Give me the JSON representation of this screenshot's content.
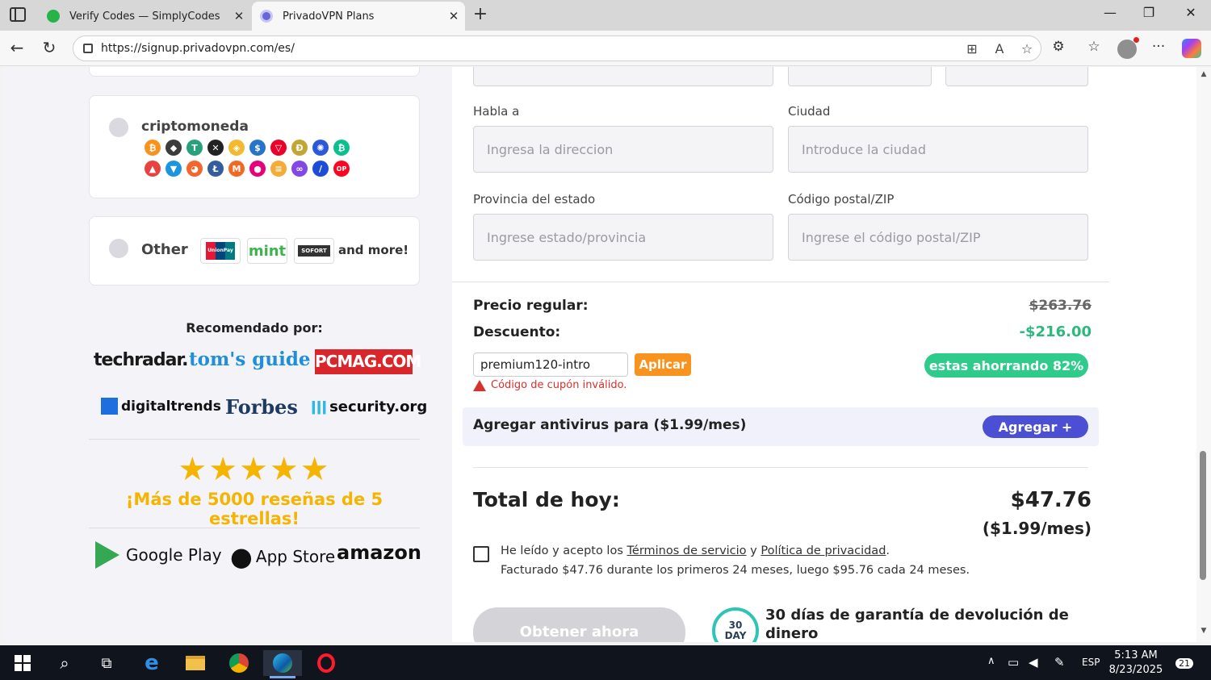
{
  "browser": {
    "tabs": [
      {
        "title": "Verify Codes — SimplyCodes",
        "favicon_color": "#27b24a",
        "active": false
      },
      {
        "title": "PrivadoVPN Plans",
        "favicon_color": "#6a66d9",
        "active": true
      }
    ],
    "url": "https://signup.privadovpn.com/es/"
  },
  "payment_options": {
    "crypto_label": "criptomoneda",
    "coins": [
      {
        "glyph": "₿",
        "color": "#f7931a"
      },
      {
        "glyph": "◆",
        "color": "#3c3c3d"
      },
      {
        "glyph": "T",
        "color": "#26a17b"
      },
      {
        "glyph": "✕",
        "color": "#222222"
      },
      {
        "glyph": "◈",
        "color": "#f3ba2f"
      },
      {
        "glyph": "$",
        "color": "#2775ca"
      },
      {
        "glyph": "▽",
        "color": "#eb0029"
      },
      {
        "glyph": "Ð",
        "color": "#c2a633"
      },
      {
        "glyph": "✺",
        "color": "#2a5ada"
      },
      {
        "glyph": "₿",
        "color": "#0ac18e"
      },
      {
        "glyph": "▲",
        "color": "#e84142"
      },
      {
        "glyph": "▼",
        "color": "#1b95e0"
      },
      {
        "glyph": "◕",
        "color": "#f4662d"
      },
      {
        "glyph": "Ł",
        "color": "#345d9d"
      },
      {
        "glyph": "M",
        "color": "#f26822"
      },
      {
        "glyph": "●",
        "color": "#e6007a"
      },
      {
        "glyph": "≡",
        "color": "#f5ac37"
      },
      {
        "glyph": "∞",
        "color": "#8247e5"
      },
      {
        "glyph": "/",
        "color": "#1b4dd8"
      },
      {
        "glyph": "OP",
        "color": "#ff0420"
      }
    ],
    "other_label": "Other",
    "other_methods": [
      "UnionPay",
      "mint",
      "SOFORT"
    ],
    "and_more": "and more!"
  },
  "recommended": {
    "title": "Recomendado por:",
    "brands": [
      "techradar.",
      "tom's guide",
      "PCMAG.COM",
      "digitaltrends",
      "Forbes",
      "security.org"
    ],
    "stars": "★★★★★",
    "reviews_text": "¡Más de 5000 reseñas de 5 estrellas!",
    "stores": [
      "Google Play",
      "App Store",
      "amazon"
    ]
  },
  "form": {
    "address_label": "Habla a",
    "address_placeholder": "Ingresa la direccion",
    "city_label": "Ciudad",
    "city_placeholder": "Introduce la ciudad",
    "state_label": "Provincia del estado",
    "state_placeholder": "Ingrese estado/provincia",
    "zip_label": "Código postal/ZIP",
    "zip_placeholder": "Ingrese el código postal/ZIP"
  },
  "pricing": {
    "regular_label": "Precio regular:",
    "regular_value": "$263.76",
    "discount_label": "Descuento:",
    "discount_value": "-$216.00",
    "coupon_value": "premium120-intro",
    "apply_label": "Aplicar",
    "coupon_error": "Código de cupón inválido.",
    "savings_badge": "estas ahorrando 82%",
    "antivirus_text": "Agregar antivirus para ($1.99/mes)",
    "antivirus_button": "Agregar +",
    "total_label": "Total de hoy:",
    "total_value": "$47.76",
    "total_monthly": "($1.99/mes)",
    "terms_prefix": "He leído y acepto los",
    "terms_link": "Términos de servicio",
    "terms_and": "y",
    "privacy_link": "Política de privacidad",
    "terms_end": ".",
    "billing_note": "Facturado $47.76 durante los primeros 24 meses, luego $95.76 cada 24 meses.",
    "cta_label": "Obtener ahora",
    "badge_top": "30",
    "badge_bottom": "DAY",
    "guarantee_text": "30 días de garantía de devolución de dinero"
  },
  "taskbar": {
    "language": "ESP",
    "time": "5:13 AM",
    "date": "8/23/2025",
    "notifications": "21"
  }
}
